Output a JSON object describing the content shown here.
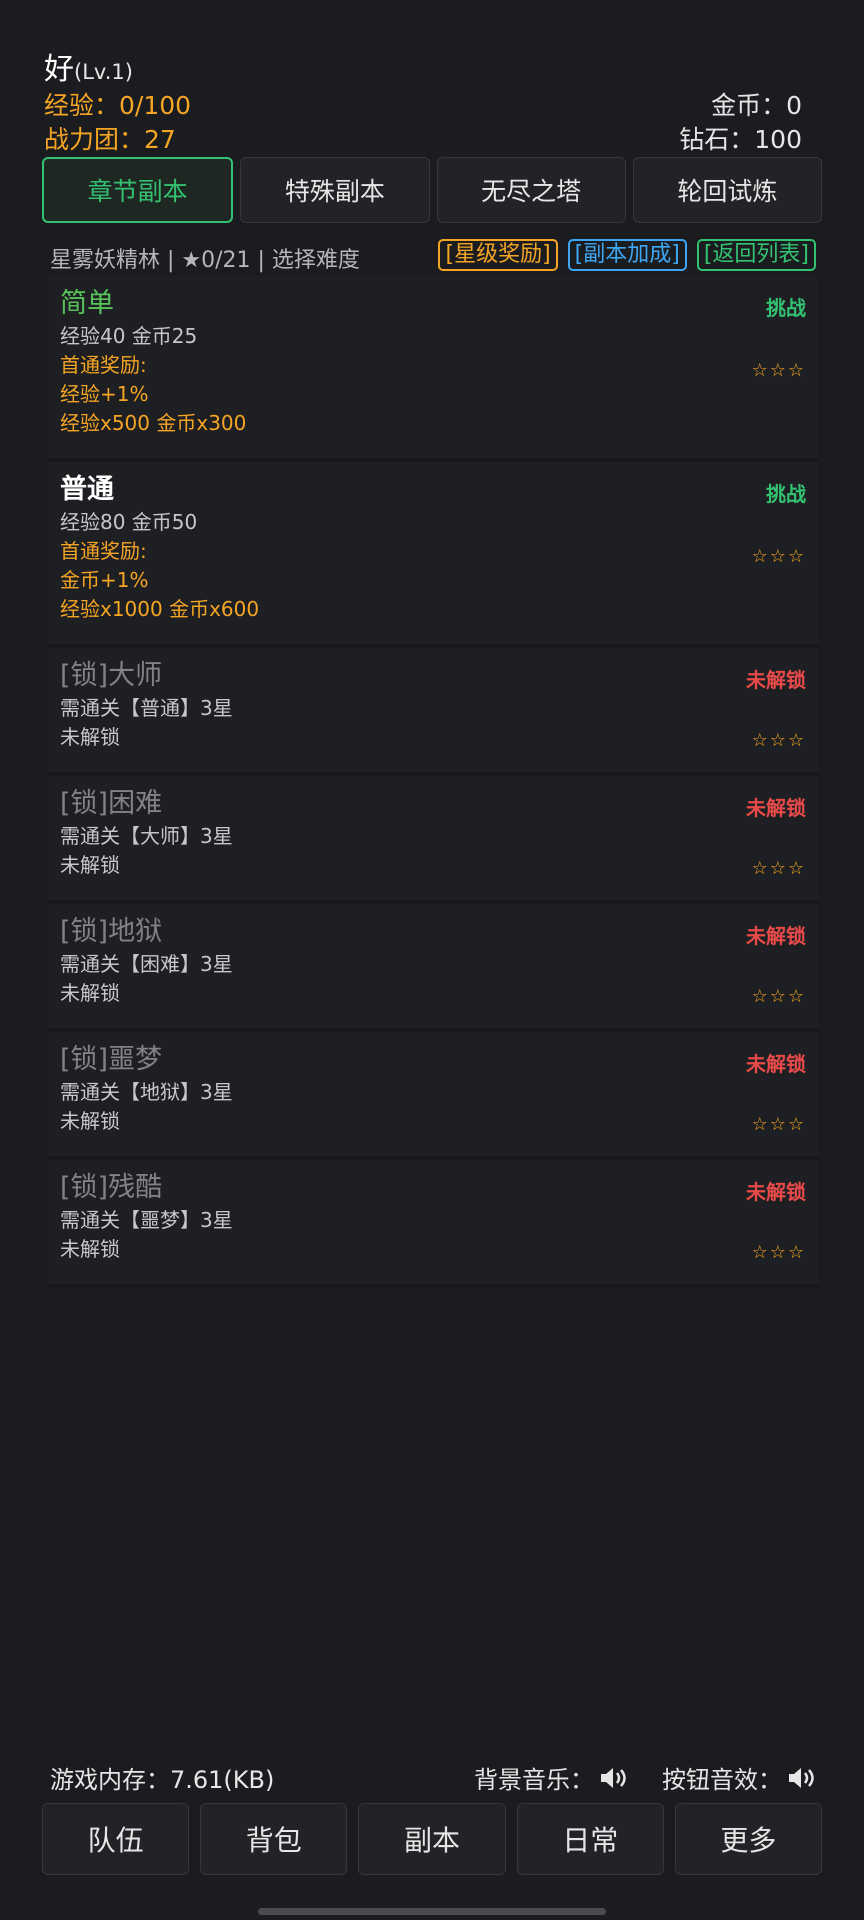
{
  "player": {
    "name": "好",
    "level": "(Lv.1)",
    "exp": "经验：0/100",
    "power": "战力团：27",
    "gold": "金币：0",
    "diamond": "钻石：100"
  },
  "tabs": [
    {
      "label": "章节副本",
      "active": true
    },
    {
      "label": "特殊副本"
    },
    {
      "label": "无尽之塔"
    },
    {
      "label": "轮回试炼"
    }
  ],
  "chapter": {
    "info": "星雾妖精林 | ★0/21 | 选择难度",
    "chips": {
      "star": "[星级奖励]",
      "bonus": "[副本加成]",
      "back": "[返回列表]"
    }
  },
  "difficulties": [
    {
      "title": "简单",
      "reward": "经验40   金币25",
      "first_label": "首通奖励:",
      "first_bonus": "经验+1%",
      "first_items": "经验x500 金币x300",
      "action": "挑战",
      "stars": "☆☆☆"
    },
    {
      "title": "普通",
      "reward": "经验80   金币50",
      "first_label": "首通奖励:",
      "first_bonus": "金币+1%",
      "first_items": "经验x1000 金币x600",
      "action": "挑战",
      "stars": "☆☆☆"
    },
    {
      "title": "[锁]大师",
      "req": "需通关【普通】3星",
      "status": "未解锁",
      "action": "未解锁",
      "stars": "☆☆☆"
    },
    {
      "title": "[锁]困难",
      "req": "需通关【大师】3星",
      "status": "未解锁",
      "action": "未解锁",
      "stars": "☆☆☆"
    },
    {
      "title": "[锁]地狱",
      "req": "需通关【困难】3星",
      "status": "未解锁",
      "action": "未解锁",
      "stars": "☆☆☆"
    },
    {
      "title": "[锁]噩梦",
      "req": "需通关【地狱】3星",
      "status": "未解锁",
      "action": "未解锁",
      "stars": "☆☆☆"
    },
    {
      "title": "[锁]残酷",
      "req": "需通关【噩梦】3星",
      "status": "未解锁",
      "action": "未解锁",
      "stars": "☆☆☆"
    }
  ],
  "footer": {
    "memory": "游戏内存：7.61(KB)",
    "bgm": "背景音乐：",
    "button_sound": "按钮音效："
  },
  "nav": [
    "队伍",
    "背包",
    "副本",
    "日常",
    "更多"
  ],
  "colors": {
    "accent_green": "#32c271",
    "orange": "#f5a524",
    "blue": "#3ea7f3",
    "red": "#e84a4a"
  }
}
